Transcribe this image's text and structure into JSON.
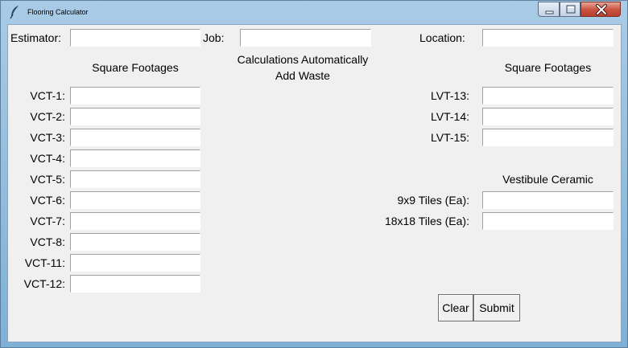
{
  "window": {
    "title": "Flooring Calculator"
  },
  "header": {
    "estimator": {
      "label": "Estimator:",
      "value": ""
    },
    "job": {
      "label": "Job:",
      "value": ""
    },
    "location": {
      "label": "Location:",
      "value": ""
    }
  },
  "left_section": {
    "heading": "Square Footages",
    "fields": [
      {
        "label": "VCT-1:",
        "value": ""
      },
      {
        "label": "VCT-2:",
        "value": ""
      },
      {
        "label": "VCT-3:",
        "value": ""
      },
      {
        "label": "VCT-4:",
        "value": ""
      },
      {
        "label": "VCT-5:",
        "value": ""
      },
      {
        "label": "VCT-6:",
        "value": ""
      },
      {
        "label": "VCT-7:",
        "value": ""
      },
      {
        "label": "VCT-8:",
        "value": ""
      },
      {
        "label": "VCT-11:",
        "value": ""
      },
      {
        "label": "VCT-12:",
        "value": ""
      }
    ]
  },
  "center_note": {
    "line1": "Calculations Automatically",
    "line2": "Add Waste"
  },
  "right_section": {
    "heading": "Square Footages",
    "fields": [
      {
        "label": "LVT-13:",
        "value": ""
      },
      {
        "label": "LVT-14:",
        "value": ""
      },
      {
        "label": "LVT-15:",
        "value": ""
      }
    ]
  },
  "vestibule_section": {
    "heading": "Vestibule Ceramic",
    "fields": [
      {
        "label": "9x9 Tiles (Ea):",
        "value": ""
      },
      {
        "label": "18x18 Tiles (Ea):",
        "value": ""
      }
    ]
  },
  "buttons": {
    "clear": "Clear",
    "submit": "Submit"
  }
}
